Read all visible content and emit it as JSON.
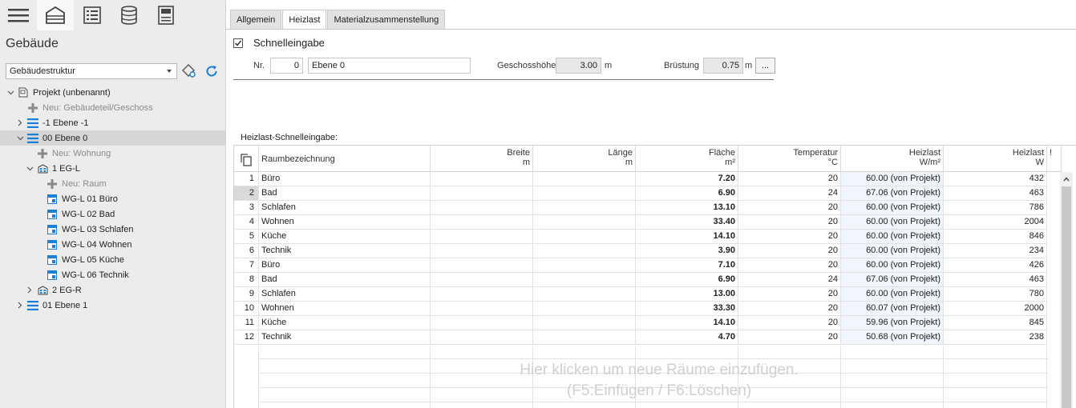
{
  "left": {
    "toolbar": [
      "menu-icon",
      "building-icon",
      "list-icon",
      "database-icon",
      "calculator-icon"
    ],
    "title": "Gebäude",
    "select_value": "Gebäudestruktur",
    "tree": [
      {
        "label": "Projekt (unbenannt)",
        "indent": 0,
        "exp": "open",
        "icon": "project",
        "grey": false,
        "sel": false
      },
      {
        "label": "Neu: Gebäudeteil/Geschoss",
        "indent": 1,
        "exp": "",
        "icon": "plus",
        "grey": true,
        "sel": false
      },
      {
        "label": "-1 Ebene -1",
        "indent": 1,
        "exp": "closed",
        "icon": "level",
        "grey": false,
        "sel": false
      },
      {
        "label": "00 Ebene 0",
        "indent": 1,
        "exp": "open",
        "icon": "level",
        "grey": false,
        "sel": true
      },
      {
        "label": "Neu: Wohnung",
        "indent": 2,
        "exp": "",
        "icon": "plus",
        "grey": true,
        "sel": false
      },
      {
        "label": "1 EG-L",
        "indent": 2,
        "exp": "open",
        "icon": "apartment",
        "grey": false,
        "sel": false
      },
      {
        "label": "Neu: Raum",
        "indent": 3,
        "exp": "",
        "icon": "plus",
        "grey": true,
        "sel": false
      },
      {
        "label": "WG-L 01 Büro",
        "indent": 3,
        "exp": "",
        "icon": "room",
        "grey": false,
        "sel": false
      },
      {
        "label": "WG-L 02 Bad",
        "indent": 3,
        "exp": "",
        "icon": "room",
        "grey": false,
        "sel": false
      },
      {
        "label": "WG-L 03 Schlafen",
        "indent": 3,
        "exp": "",
        "icon": "room",
        "grey": false,
        "sel": false
      },
      {
        "label": "WG-L 04 Wohnen",
        "indent": 3,
        "exp": "",
        "icon": "room",
        "grey": false,
        "sel": false
      },
      {
        "label": "WG-L 05 Küche",
        "indent": 3,
        "exp": "",
        "icon": "room",
        "grey": false,
        "sel": false
      },
      {
        "label": "WG-L 06 Technik",
        "indent": 3,
        "exp": "",
        "icon": "room",
        "grey": false,
        "sel": false
      },
      {
        "label": "2 EG-R",
        "indent": 2,
        "exp": "closed",
        "icon": "apartment",
        "grey": false,
        "sel": false
      },
      {
        "label": "01 Ebene 1",
        "indent": 1,
        "exp": "closed",
        "icon": "level",
        "grey": false,
        "sel": false
      }
    ]
  },
  "tabs": [
    "Allgemein",
    "Heizlast",
    "Materialzusammenstellung"
  ],
  "active_tab": "Heizlast",
  "form": {
    "quick_label": "Schnelleingabe",
    "quick_checked": true,
    "nr_label": "Nr.",
    "nr_value": "0",
    "name_value": "Ebene 0",
    "height_label": "Geschosshöhe",
    "height_value": "3.00",
    "height_unit": "m",
    "sill_label": "Brüstung",
    "sill_value": "0.75",
    "sill_unit": "m",
    "dots": "..."
  },
  "grid": {
    "caption": "Heizlast-Schnelleingabe:",
    "headers": [
      {
        "label": "Raumbezeichnung",
        "unit": ""
      },
      {
        "label": "Breite",
        "unit": "m"
      },
      {
        "label": "Länge",
        "unit": "m"
      },
      {
        "label": "Fläche",
        "unit": "m²"
      },
      {
        "label": "Temperatur",
        "unit": "°C"
      },
      {
        "label": "Heizlast",
        "unit": "W/m²"
      },
      {
        "label": "Heizlast",
        "unit": "W"
      },
      {
        "label": "!",
        "unit": ""
      }
    ],
    "rows": [
      {
        "nr": "1",
        "name": "Büro",
        "breite": "",
        "laenge": "",
        "flaeche": "7.20",
        "temp": "20",
        "wm2": "60.00 (von Projekt)",
        "w": "432"
      },
      {
        "nr": "2",
        "name": "Bad",
        "breite": "",
        "laenge": "",
        "flaeche": "6.90",
        "temp": "24",
        "wm2": "67.06 (von Projekt)",
        "w": "463"
      },
      {
        "nr": "3",
        "name": "Schlafen",
        "breite": "",
        "laenge": "",
        "flaeche": "13.10",
        "temp": "20",
        "wm2": "60.00 (von Projekt)",
        "w": "786"
      },
      {
        "nr": "4",
        "name": "Wohnen",
        "breite": "",
        "laenge": "",
        "flaeche": "33.40",
        "temp": "20",
        "wm2": "60.00 (von Projekt)",
        "w": "2004"
      },
      {
        "nr": "5",
        "name": "Küche",
        "breite": "",
        "laenge": "",
        "flaeche": "14.10",
        "temp": "20",
        "wm2": "60.00 (von Projekt)",
        "w": "846"
      },
      {
        "nr": "6",
        "name": "Technik",
        "breite": "",
        "laenge": "",
        "flaeche": "3.90",
        "temp": "20",
        "wm2": "60.00 (von Projekt)",
        "w": "234"
      },
      {
        "nr": "7",
        "name": "Büro",
        "breite": "",
        "laenge": "",
        "flaeche": "7.10",
        "temp": "20",
        "wm2": "60.00 (von Projekt)",
        "w": "426"
      },
      {
        "nr": "8",
        "name": "Bad",
        "breite": "",
        "laenge": "",
        "flaeche": "6.90",
        "temp": "24",
        "wm2": "67.06 (von Projekt)",
        "w": "463"
      },
      {
        "nr": "9",
        "name": "Schlafen",
        "breite": "",
        "laenge": "",
        "flaeche": "13.00",
        "temp": "20",
        "wm2": "60.00 (von Projekt)",
        "w": "780"
      },
      {
        "nr": "10",
        "name": "Wohnen",
        "breite": "",
        "laenge": "",
        "flaeche": "33.30",
        "temp": "20",
        "wm2": "60.07 (von Projekt)",
        "w": "2000"
      },
      {
        "nr": "11",
        "name": "Küche",
        "breite": "",
        "laenge": "",
        "flaeche": "14.10",
        "temp": "20",
        "wm2": "59.96 (von Projekt)",
        "w": "845"
      },
      {
        "nr": "12",
        "name": "Technik",
        "breite": "",
        "laenge": "",
        "flaeche": "4.70",
        "temp": "20",
        "wm2": "50.68 (von Projekt)",
        "w": "238"
      }
    ],
    "selected_row": "2",
    "hint_line1": "Hier klicken um neue Räume einzufügen.",
    "hint_line2": "(F5:Einfügen / F6:Löschen)"
  },
  "colors": {
    "accent": "#1a7fd6",
    "selection": "#d6d6d6"
  }
}
